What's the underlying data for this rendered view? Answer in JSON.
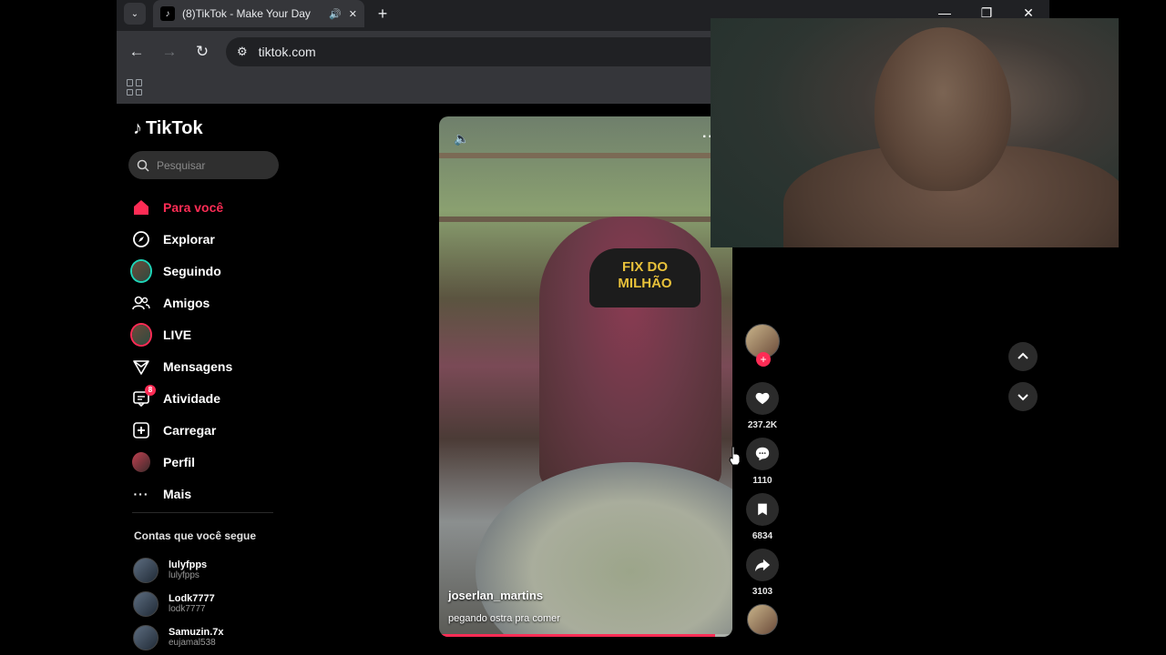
{
  "browser": {
    "tab_title": "(8)TikTok - Make Your Day",
    "url": "tiktok.com",
    "new_tab": "+",
    "tab_close": "✕"
  },
  "window_controls": {
    "minimize": "—",
    "restore": "❐",
    "close": "✕"
  },
  "tiktok": {
    "logo": "TikTok",
    "search_placeholder": "Pesquisar",
    "nav": [
      {
        "label": "Para você",
        "icon": "home-icon",
        "active": true
      },
      {
        "label": "Explorar",
        "icon": "compass-icon"
      },
      {
        "label": "Seguindo",
        "icon": "avatar-icon"
      },
      {
        "label": "Amigos",
        "icon": "friends-icon"
      },
      {
        "label": "LIVE",
        "icon": "live-avatar-icon"
      },
      {
        "label": "Mensagens",
        "icon": "send-icon"
      },
      {
        "label": "Atividade",
        "icon": "activity-icon",
        "badge": "8"
      },
      {
        "label": "Carregar",
        "icon": "upload-icon"
      },
      {
        "label": "Perfil",
        "icon": "profile-avatar-icon"
      },
      {
        "label": "Mais",
        "icon": "more-icon"
      }
    ],
    "following_title": "Contas que você segue",
    "accounts": [
      {
        "name": "lulyfpps",
        "handle": "lulyfpps"
      },
      {
        "name": "Lodk7777",
        "handle": "lodk7777"
      },
      {
        "name": "Samuzin.7x",
        "handle": "eujamal538"
      }
    ],
    "video": {
      "author": "joserlan_martins",
      "caption": "pegando ostra pra comer",
      "cap_text": "FIX DO\nMILHÃO",
      "progress": 0.94
    },
    "actions": {
      "likes": "237.2K",
      "comments": "1110",
      "saves": "6834",
      "shares": "3103"
    }
  },
  "colors": {
    "accent": "#fe2c55",
    "bg": "#000000"
  }
}
